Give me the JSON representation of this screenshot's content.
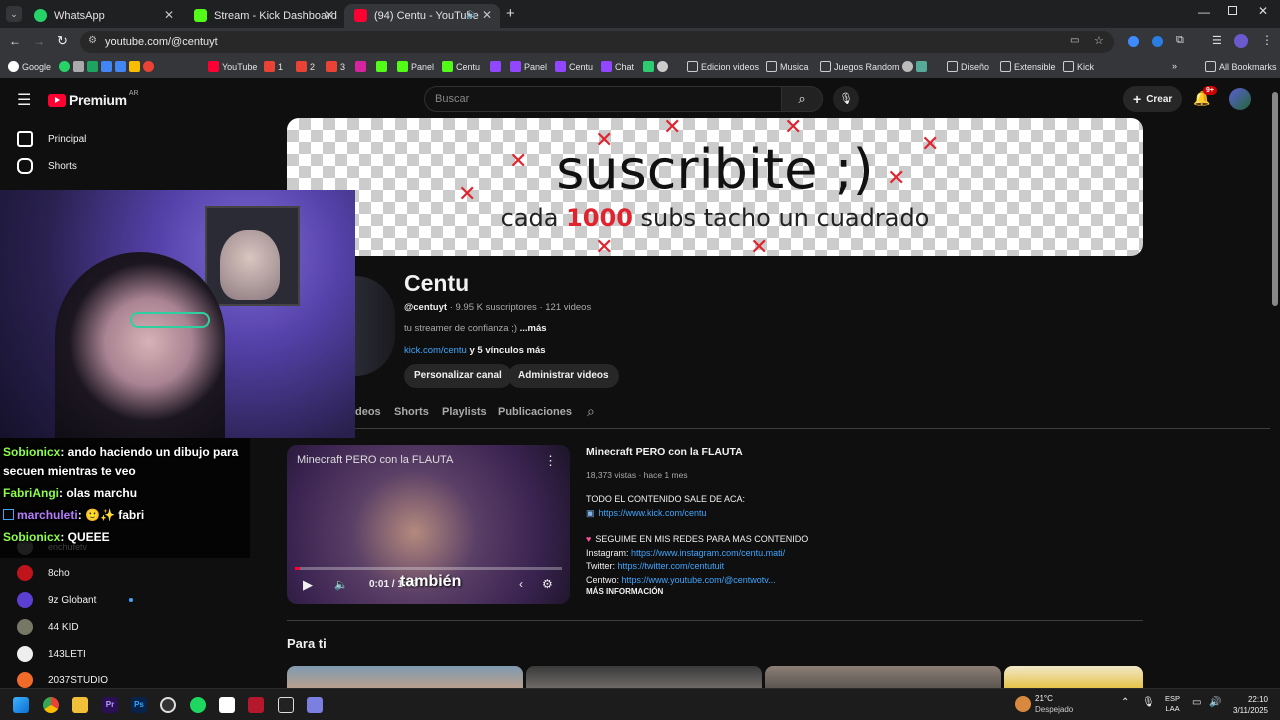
{
  "browser": {
    "tabs": [
      {
        "label": "WhatsApp",
        "color": "#25d366"
      },
      {
        "label": "Stream - Kick Dashboard",
        "color": "#53fc18"
      },
      {
        "label": "(94) Centu - YouTube",
        "color": "#ff0033"
      }
    ],
    "url": "youtube.com/@centuyt",
    "bookmarks": [
      "Google",
      "YouTube",
      "1",
      "2",
      "3",
      "Panel",
      "Centu",
      "Panel",
      "Centu",
      "Chat",
      "Edicion videos",
      "Musica",
      "Juegos Random",
      "Diseño",
      "Extensible",
      "Kick"
    ],
    "all_bookmarks": "All Bookmarks"
  },
  "yt": {
    "logo": "Premium",
    "logo_region": "AR",
    "search_placeholder": "Buscar",
    "create_label": "Crear",
    "notif_badge": "9+",
    "sidebar_top": [
      "Principal",
      "Shorts"
    ],
    "subs": [
      "enchufetv",
      "8cho",
      "9z Globant",
      "44 KID",
      "143LETI",
      "2037STUDIO"
    ],
    "banner_title": "suscribite ;)",
    "banner_sub_a": "cada",
    "banner_sub_num": "1000",
    "banner_sub_b": "subs tacho un cuadrado",
    "channel_name": "Centu",
    "handle": "@centuyt",
    "stats": "· 9.95 K suscriptores · 121 videos",
    "desc": "tu streamer de confianza ;)",
    "desc_more": "...más",
    "link_main": "kick.com/centu",
    "link_more": "y 5 vínculos más",
    "btn_customize": "Personalizar canal",
    "btn_manage": "Administrar videos",
    "tabs": [
      "deos",
      "Shorts",
      "Playlists",
      "Publicaciones"
    ],
    "video": {
      "overlay_title": "Minecraft PERO con la FLAUTA",
      "time": "0:01 / 1:05",
      "caption": "también",
      "title": "Minecraft PERO con la FLAUTA",
      "meta": "18,373 vistas · hace 1 mes",
      "d1": "TODO EL CONTENIDO SALE DE ACA:",
      "d2": "https://www.kick.com/centu",
      "d3": "SEGUIME EN MIS REDES PARA MAS CONTENIDO",
      "d4a": "Instagram:",
      "d4b": "https://www.instagram.com/centu.mati/",
      "d5a": "Twitter:",
      "d5b": "https://twitter.com/centutuit",
      "d6a": "Centwo:",
      "d6b": "https://www.youtube.com/@centwotv...",
      "more": "MÁS INFORMACIÓN"
    },
    "for_you": "Para ti"
  },
  "chat": [
    {
      "user": "Sobionicx",
      "msg": ": ando haciendo un dibujo para"
    },
    {
      "user": "",
      "msg": "secuen mientras te veo"
    },
    {
      "user": "FabriAngi",
      "msg": ": olas marchu"
    },
    {
      "user": "marchuleti",
      "msg": ": 🙂✨ fabri"
    },
    {
      "user": "Sobionicx",
      "msg": ": QUEEE"
    }
  ],
  "taskbar": {
    "weather_temp": "21°C",
    "weather_desc": "Despejado",
    "lang1": "ESP",
    "lang2": "LAA",
    "time": "22:10",
    "date": "3/11/2025"
  }
}
